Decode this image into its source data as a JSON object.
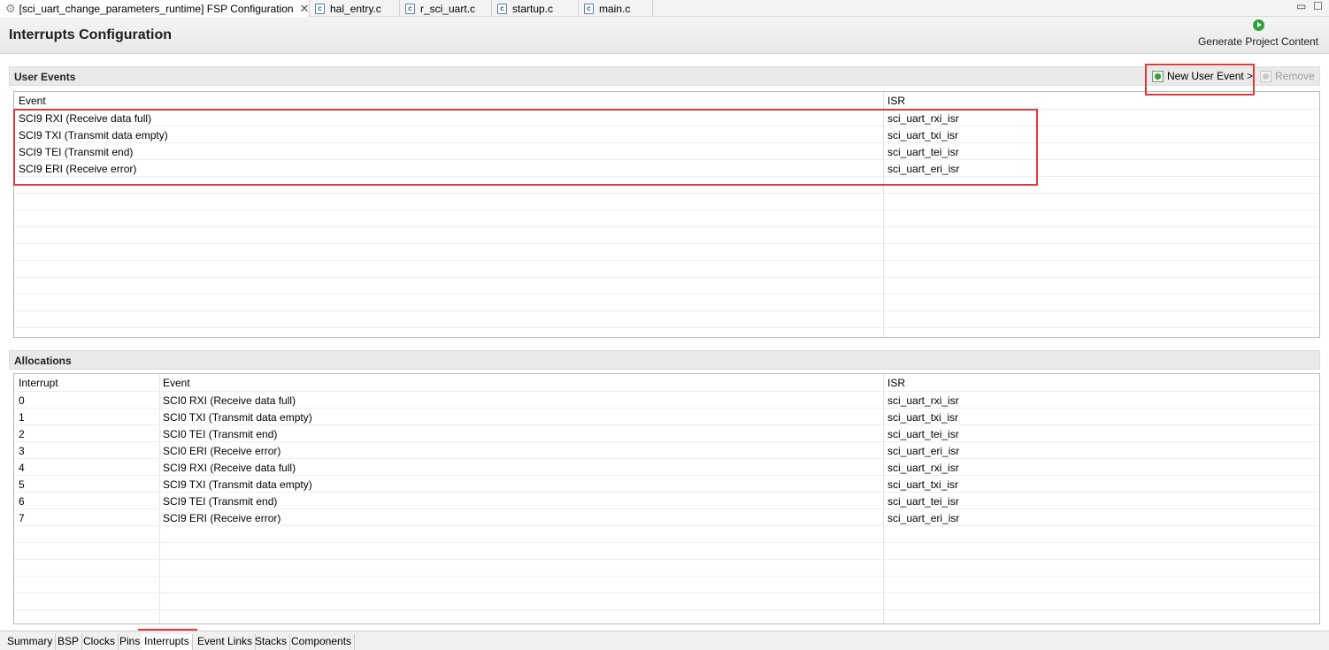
{
  "editor_tabs": [
    {
      "label": "[sci_uart_change_parameters_runtime] FSP Configuration",
      "icon": "gear-icon",
      "close": "✕"
    },
    {
      "label": "hal_entry.c",
      "icon": "c-file-icon"
    },
    {
      "label": "r_sci_uart.c",
      "icon": "c-file-icon"
    },
    {
      "label": "startup.c",
      "icon": "c-file-icon"
    },
    {
      "label": "main.c",
      "icon": "c-file-icon"
    }
  ],
  "window_controls": {
    "minimize": "▭",
    "maximize": "☐"
  },
  "page_title": "Interrupts Configuration",
  "generate_button": {
    "label": "Generate Project Content",
    "icon": "play-icon"
  },
  "user_events": {
    "title": "User Events",
    "new_button": "New User Event >",
    "remove_button": "Remove",
    "columns": [
      "Event",
      "ISR"
    ],
    "rows": [
      {
        "event": "SCI9 RXI (Receive data full)",
        "isr": "sci_uart_rxi_isr"
      },
      {
        "event": "SCI9 TXI (Transmit data empty)",
        "isr": "sci_uart_txi_isr"
      },
      {
        "event": "SCI9 TEI (Transmit end)",
        "isr": "sci_uart_tei_isr"
      },
      {
        "event": "SCI9 ERI (Receive error)",
        "isr": "sci_uart_eri_isr"
      }
    ]
  },
  "allocations": {
    "title": "Allocations",
    "columns": [
      "Interrupt",
      "Event",
      "ISR"
    ],
    "rows": [
      {
        "interrupt": "0",
        "event": "SCI0 RXI (Receive data full)",
        "isr": "sci_uart_rxi_isr"
      },
      {
        "interrupt": "1",
        "event": "SCI0 TXI (Transmit data empty)",
        "isr": "sci_uart_txi_isr"
      },
      {
        "interrupt": "2",
        "event": "SCI0 TEI (Transmit end)",
        "isr": "sci_uart_tei_isr"
      },
      {
        "interrupt": "3",
        "event": "SCI0 ERI (Receive error)",
        "isr": "sci_uart_eri_isr"
      },
      {
        "interrupt": "4",
        "event": "SCI9 RXI (Receive data full)",
        "isr": "sci_uart_rxi_isr"
      },
      {
        "interrupt": "5",
        "event": "SCI9 TXI (Transmit data empty)",
        "isr": "sci_uart_txi_isr"
      },
      {
        "interrupt": "6",
        "event": "SCI9 TEI (Transmit end)",
        "isr": "sci_uart_tei_isr"
      },
      {
        "interrupt": "7",
        "event": "SCI9 ERI (Receive error)",
        "isr": "sci_uart_eri_isr"
      }
    ]
  },
  "page_tabs": [
    "Summary",
    "BSP",
    "Clocks",
    "Pins",
    "Interrupts",
    "Event Links",
    "Stacks",
    "Components"
  ],
  "active_page_tab": "Interrupts",
  "colors": {
    "highlight": "#e0393e",
    "accent": "#2f9e3c"
  }
}
